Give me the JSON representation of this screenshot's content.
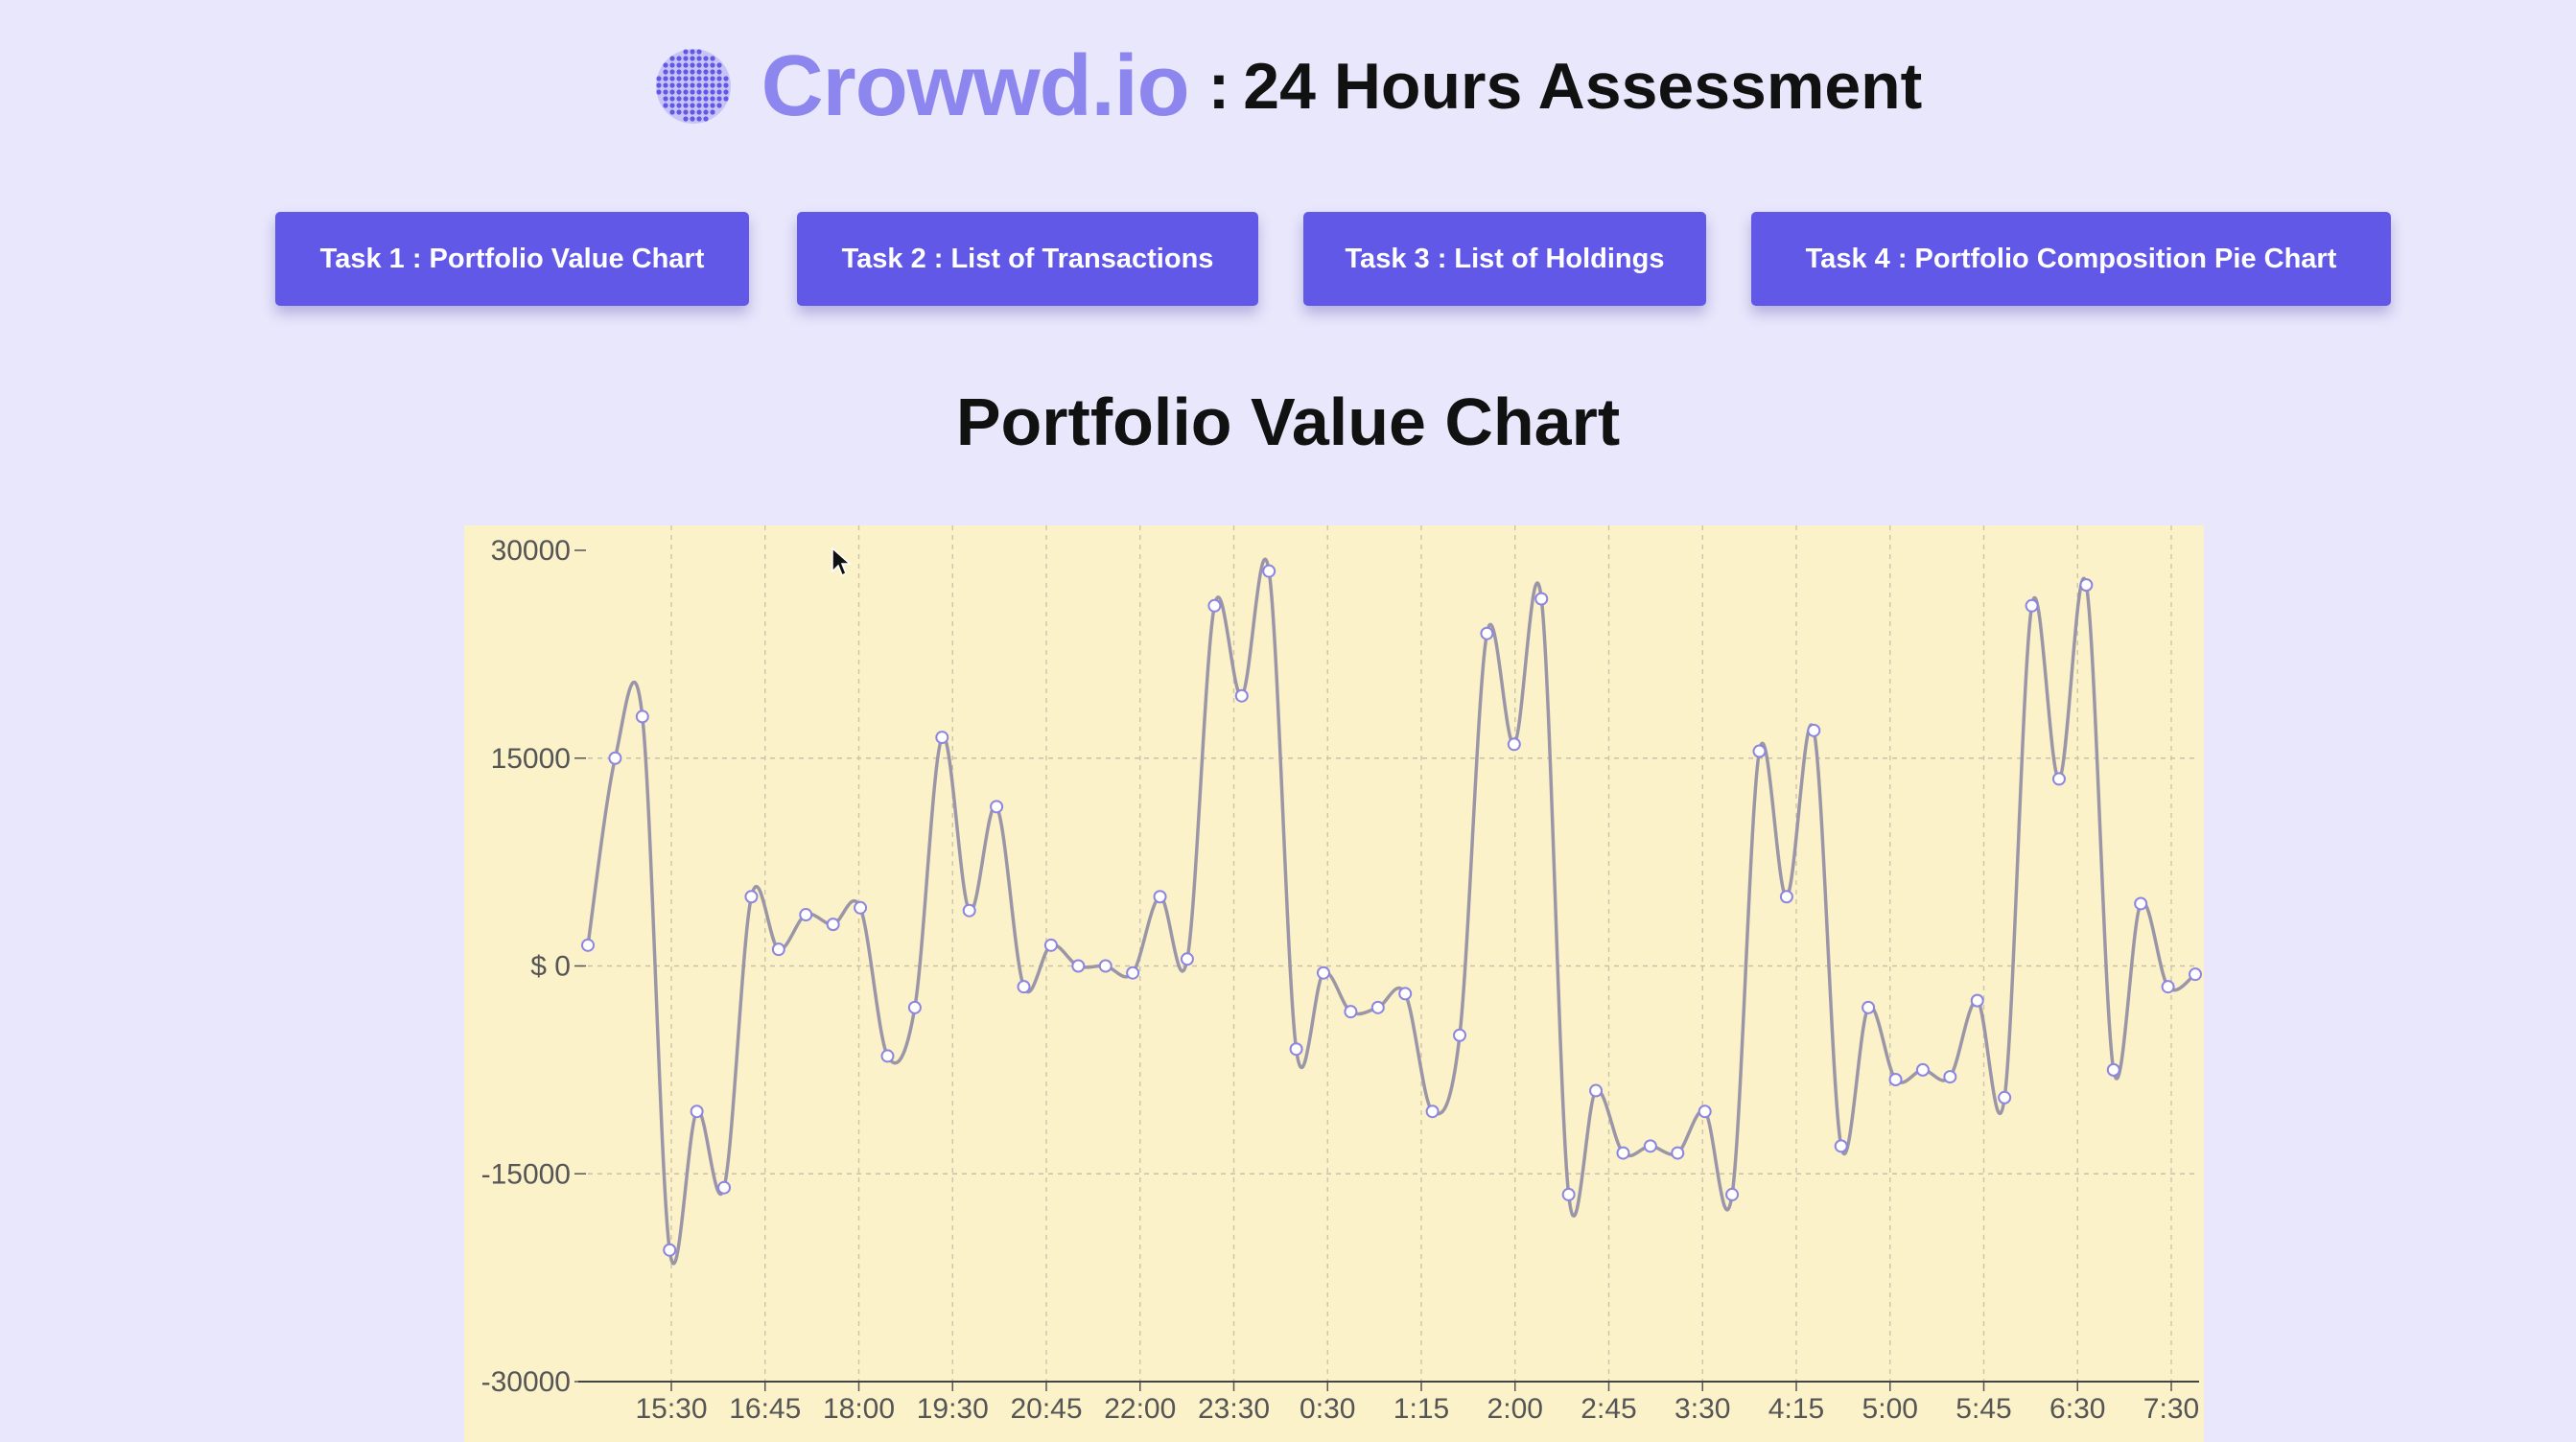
{
  "header": {
    "brand": "Crowwd.io",
    "separator": ":",
    "subtitle": "24 Hours Assessment",
    "logo_icon": "globe-dots-icon"
  },
  "tasks": [
    {
      "label": "Task 1 : Portfolio Value Chart"
    },
    {
      "label": "Task 2 : List of Transactions"
    },
    {
      "label": "Task 3 : List of Holdings"
    },
    {
      "label": "Task 4 : Portfolio Composition Pie Chart"
    }
  ],
  "section_title": "Portfolio Value Chart",
  "colors": {
    "background": "#e9e7fb",
    "accent": "#6158e8",
    "brand": "#8d86ee",
    "chart_bg": "#fcf2c9",
    "line": "#9a96a8",
    "marker_stroke": "#8c86e0"
  },
  "chart_data": {
    "type": "line",
    "ylim": [
      -30000,
      30000
    ],
    "yticks": [
      30000,
      15000,
      0,
      -15000,
      -30000
    ],
    "ytick_labels": [
      "30000",
      "15000",
      "$ 0",
      "-15000",
      "-30000"
    ],
    "xticks": [
      "15:30",
      "16:45",
      "18:00",
      "19:30",
      "20:45",
      "22:00",
      "23:30",
      "0:30",
      "1:15",
      "2:00",
      "2:45",
      "3:30",
      "4:15",
      "5:00",
      "5:45",
      "6:30",
      "7:30"
    ],
    "grid": true,
    "legend": "none",
    "series": [
      {
        "values": [
          1500,
          15000,
          18000,
          -20500,
          -10500,
          -16000,
          5000,
          1200,
          3700,
          3000,
          4200,
          -6500,
          -3000,
          16500,
          4000,
          11500,
          -1500,
          1500,
          0,
          0,
          -500,
          5000,
          500,
          26000,
          19500,
          28500,
          -6000,
          -500,
          -3300,
          -3000,
          -2000,
          -10500,
          -5000,
          24000,
          16000,
          26500,
          -16500,
          -9000,
          -13500,
          -13000,
          -13500,
          -10500,
          -16500,
          15500,
          5000,
          17000,
          -13000,
          -3000,
          -8200,
          -7500,
          -8000,
          -2500,
          -9500,
          26000,
          13500,
          27500,
          -7500,
          4500,
          -1500,
          -600
        ]
      }
    ]
  }
}
